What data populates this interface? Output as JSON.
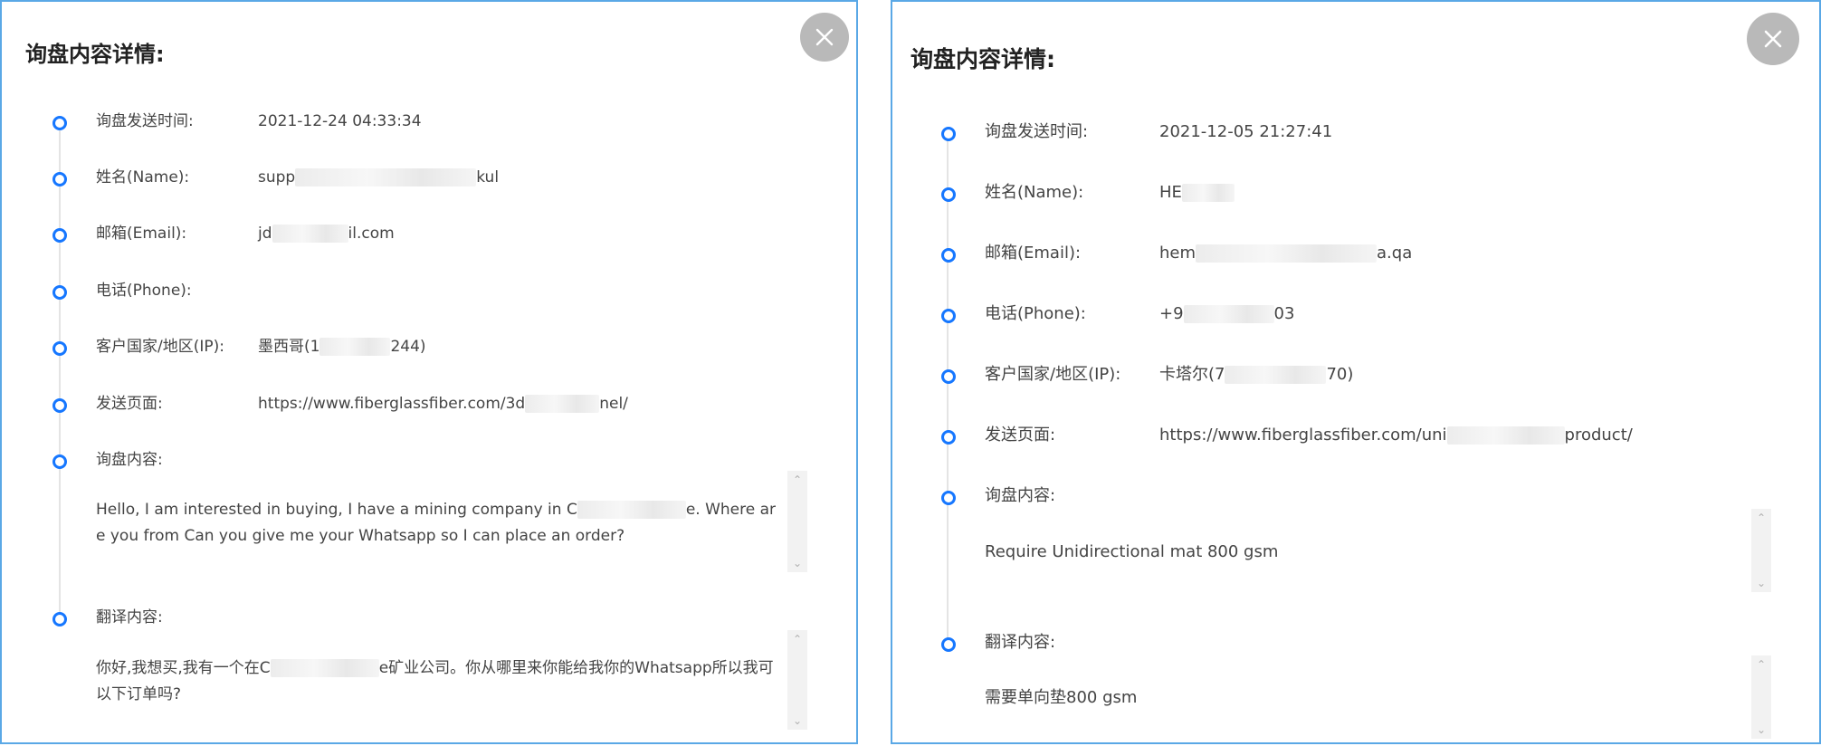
{
  "left": {
    "title": "询盘内容详情:",
    "close_glyph": "✕",
    "fields": [
      {
        "label": "询盘发送时间:",
        "value_pre": "2021-12-24 04:33:34",
        "value_post": ""
      },
      {
        "label": "姓名(Name):",
        "value_pre": "supp",
        "value_post": "kul"
      },
      {
        "label": "邮箱(Email):",
        "value_pre": "jd",
        "value_post": "il.com"
      },
      {
        "label": "电话(Phone):",
        "value_pre": "",
        "value_post": ""
      },
      {
        "label": "客户国家/地区(IP):",
        "value_pre": "墨西哥(1",
        "value_post": "244)"
      },
      {
        "label": "发送页面:",
        "value_pre": "https://www.fiberglassfiber.com/3d",
        "value_post": "nel/"
      }
    ],
    "inquiry_label": "询盘内容:",
    "inquiry_pre": "Hello, I am interested in buying, I have a mining company in C",
    "inquiry_post": "e. Where are you from Can you give me your Whatsapp so I can place an order?",
    "translation_label": "翻译内容:",
    "translation_pre": "你好,我想买,我有一个在C",
    "translation_post": "e矿业公司。你从哪里来你能给我你的Whatsapp所以我可以下订单吗?"
  },
  "right": {
    "title": "询盘内容详情:",
    "close_glyph": "✕",
    "fields": [
      {
        "label": "询盘发送时间:",
        "value_pre": "2021-12-05 21:27:41",
        "value_post": ""
      },
      {
        "label": "姓名(Name):",
        "value_pre": "HE",
        "value_post": ""
      },
      {
        "label": "邮箱(Email):",
        "value_pre": "hem",
        "value_post": "a.qa"
      },
      {
        "label": "电话(Phone):",
        "value_pre": "+9",
        "value_post": "03"
      },
      {
        "label": "客户国家/地区(IP):",
        "value_pre": "卡塔尔(7",
        "value_post": "70)"
      },
      {
        "label": "发送页面:",
        "value_pre": "https://www.fiberglassfiber.com/uni",
        "value_post": "product/"
      }
    ],
    "inquiry_label": "询盘内容:",
    "inquiry_text": "Require Unidirectional mat 800 gsm",
    "translation_label": "翻译内容:",
    "translation_text": "需要单向垫800 gsm"
  },
  "scroll": {
    "up_glyph": "⌃",
    "down_glyph": "⌄"
  },
  "colors": {
    "border": "#5aa8e6",
    "dot": "#1677ff",
    "close_bg": "#b9b9b9"
  }
}
